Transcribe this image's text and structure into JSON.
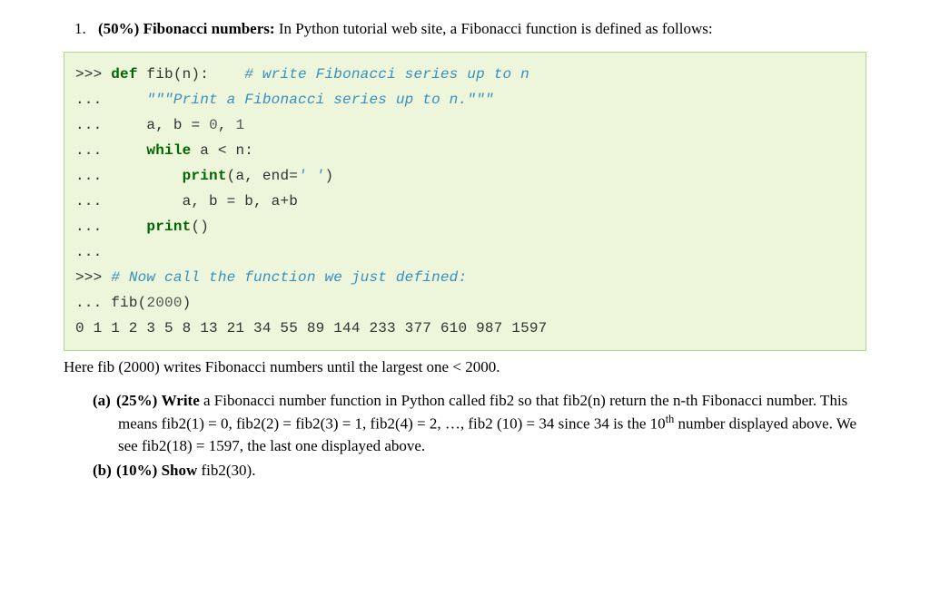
{
  "q1": {
    "marker": "1.",
    "weight": "(50%)",
    "title": "Fibonacci numbers:",
    "intro": " In Python tutorial web site, a Fibonacci function is defined as follows:"
  },
  "code": {
    "l1_prompt": ">>> ",
    "l1_def": "def",
    "l1_sig": " fib(n):    ",
    "l1_comment": "# write Fibonacci series up to n",
    "l2_prompt": "...     ",
    "l2_docstring": "\"\"\"Print a Fibonacci series up to n.\"\"\"",
    "l3_prompt": "...     ",
    "l3_text_a": "a, b ",
    "l3_eq": "=",
    "l3_text_b": " ",
    "l3_zero": "0",
    "l3_text_c": ", ",
    "l3_one": "1",
    "l4_prompt": "...     ",
    "l4_while": "while",
    "l4_cond": " a < n:",
    "l5_prompt": "...         ",
    "l5_print": "print",
    "l5_args": "(a, end=",
    "l5_str": "' '",
    "l5_close": ")",
    "l6_prompt": "...         ",
    "l6_text": "a, b ",
    "l6_eq": "=",
    "l6_rhs": " b, a+b",
    "l7_prompt": "...     ",
    "l7_print": "print",
    "l7_paren": "()",
    "l8_prompt": "...",
    "l9_prompt": ">>> ",
    "l9_comment": "# Now call the function we just defined:",
    "l10_prompt": "... ",
    "l10_call": "fib(",
    "l10_arg": "2000",
    "l10_close": ")",
    "output": "0 1 1 2 3 5 8 13 21 34 55 89 144 233 377 610 987 1597"
  },
  "explain": "Here fib (2000) writes Fibonacci numbers until the largest one < 2000.",
  "partA": {
    "marker": "(a)",
    "weight": "(25%)",
    "verb": "Write",
    "text1": " a Fibonacci number function in Python called fib2 so that fib2(n) return the n-th Fibonacci number. This means fib2(1) = 0, fib2(2) = fib2(3) = 1, fib2(4) = 2, …, fib2 (10) = 34 since 34 is the 10",
    "sup": "th",
    "text2": " number displayed above. We see fib2(18) = 1597, the last one displayed above."
  },
  "partB": {
    "marker": "(b)",
    "weight": "(10%)",
    "verb": "Show",
    "text": " fib2(30)."
  }
}
